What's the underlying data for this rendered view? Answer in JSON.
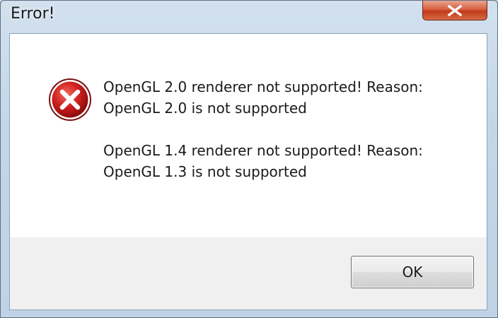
{
  "window": {
    "title": "Error!",
    "close_icon": "close-x-icon"
  },
  "dialog": {
    "icon": "error-icon",
    "messages": [
      {
        "line1": "OpenGL 2.0 renderer not supported! Reason:",
        "line2": "OpenGL 2.0 is not supported"
      },
      {
        "line1": "OpenGL 1.4 renderer not supported! Reason:",
        "line2": "OpenGL 1.3 is not supported"
      }
    ],
    "ok_label": "OK"
  },
  "colors": {
    "error_red": "#d01f1f",
    "close_button": "#c23b1a",
    "content_bg": "#ffffff",
    "footer_bg": "#f0f0f0"
  }
}
